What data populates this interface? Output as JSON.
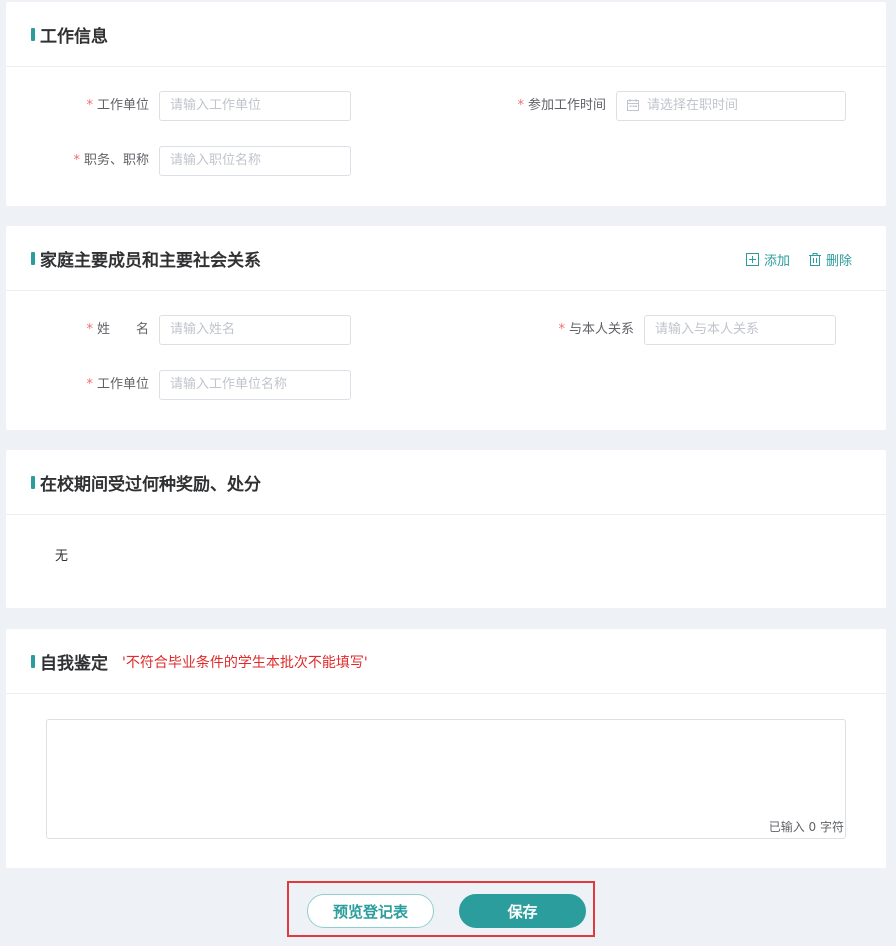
{
  "work_info": {
    "title": "工作信息",
    "work_unit": {
      "label": "工作单位",
      "placeholder": "请输入工作单位"
    },
    "start_time": {
      "label": "参加工作时间",
      "placeholder": "请选择在职时间"
    },
    "position": {
      "label": "职务、职称",
      "placeholder": "请输入职位名称"
    }
  },
  "family": {
    "title": "家庭主要成员和主要社会关系",
    "add_label": "添加",
    "delete_label": "删除",
    "name": {
      "label": "姓　　名",
      "placeholder": "请输入姓名"
    },
    "relation": {
      "label": "与本人关系",
      "placeholder": "请输入与本人关系"
    },
    "work_unit": {
      "label": "工作单位",
      "placeholder": "请输入工作单位名称"
    }
  },
  "awards": {
    "title": "在校期间受过何种奖励、处分",
    "value": "无"
  },
  "self_eval": {
    "title": "自我鉴定",
    "warning": "'不符合毕业条件的学生本批次不能填写'",
    "counter": "已输入 0 字符"
  },
  "actions": {
    "preview_label": "预览登记表",
    "save_label": "保存"
  },
  "required_mark": "*",
  "colors": {
    "accent": "#2a9d9c",
    "required": "#f56c6c",
    "warning": "#e02b2b",
    "highlight_box": "#e0393e"
  }
}
